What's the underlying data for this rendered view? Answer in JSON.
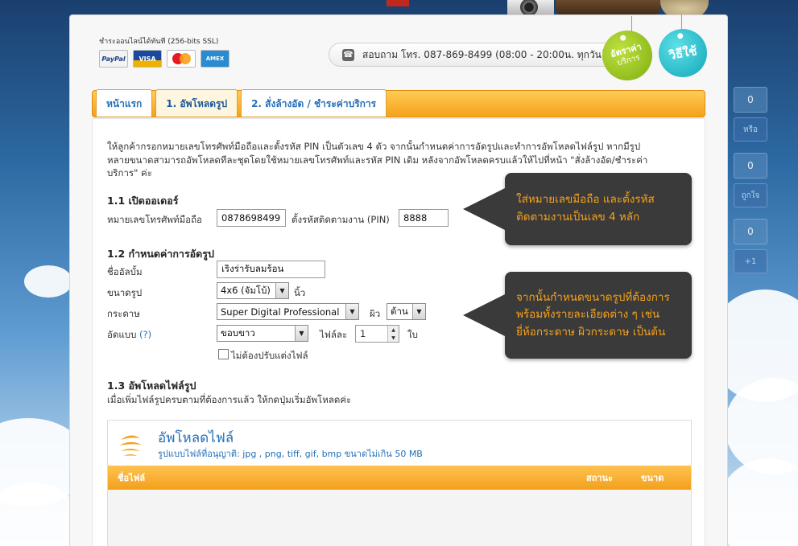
{
  "payment": {
    "label": "ชำระออนไลน์ได้ทันที (256-bits SSL)",
    "cards": [
      "PayPal",
      "VISA",
      "MasterCard",
      "AMERICAN EXPRESS"
    ]
  },
  "contact": {
    "text": "สอบถาม โทร. 087-869-8499 (08:00 - 20:00น. ทุกวัน)"
  },
  "tags": {
    "rate_line1": "อัตราค่า",
    "rate_line2": "บริการ",
    "howto": "วิธีใช้"
  },
  "tabs": [
    {
      "label": "หน้าแรก",
      "active": false
    },
    {
      "label": "1. อัพโหลดรูป",
      "active": true
    },
    {
      "label": "2. สั่งล้างอัด / ชำระค่าบริการ",
      "active": false
    }
  ],
  "intro": {
    "line1": "ให้ลูกค้ากรอกหมายเลขโทรศัพท์มือถือและตั้งรหัส PIN เป็นตัวเลข 4 ตัว จากนั้นกำหนดค่าการอัดรูปและทำการอัพโหลดไฟล์รูป หากมีรูป",
    "line2": "หลายขนาดสามารถอัพโหลดทีละชุดโดยใช้หมายเลขโทรศัพท์และรหัส PIN เดิม หลังจากอัพโหลดครบแล้วให้ไปที่หน้า \"สั่งล้างอัด/ชำระค่า",
    "line3": "บริการ\" ค่ะ"
  },
  "order": {
    "title": "1.1 เปิดออเดอร์",
    "phone_label": "หมายเลขโทรศัพท์มือถือ",
    "phone_value": "0878698499",
    "pin_label": "ตั้งรหัสติดตามงาน (PIN)",
    "pin_value": "8888"
  },
  "settings": {
    "title": "1.2 กำหนดค่าการอัดรูป",
    "album_label": "ชื่ออัลบั้ม",
    "album_value": "เริงร่ารับลมร้อน",
    "size_label": "ขนาดรูป",
    "size_value": "4x6 (จัมโบ้)",
    "size_unit": "นิ้ว",
    "paper_label": "กระดาษ",
    "paper_value": "Super Digital Professional",
    "surface_label": "ผิว",
    "surface_value": "ด้าน",
    "print_label": "อัดแบบ",
    "print_help": "(?)",
    "print_value": "ขอบขาว",
    "per_file_label": "ไฟล์ละ",
    "per_file_value": "1",
    "per_file_unit": "ใบ",
    "no_adjust_label": "ไม่ต้องปรับแต่งไฟล์",
    "no_adjust_checked": false
  },
  "upload": {
    "title": "1.3 อัพโหลดไฟล์รูป",
    "desc": "เมื่อเพิ่มไฟล์รูปครบตามที่ต้องการแล้ว ให้กดปุ่มเริ่มอัพโหลดค่ะ",
    "box_title": "อัพโหลดไฟล์",
    "box_sub": "รูปแบบไฟล์ที่อนุญาติ: jpg , png, tiff, gif, bmp ขนาดไม่เกิน 50 MB",
    "col_filename": "ชื่อไฟล์",
    "col_status": "สถานะ",
    "col_size": "ขนาด"
  },
  "tooltips": {
    "tip1_line1": "ใส่หมายเลขมือถือ และตั้งรหัส",
    "tip1_line2": "ติดตามงานเป็นเลข 4 หลัก",
    "tip2_line1": "จากนั้นกำหนดขนาดรูปที่ต้องการ",
    "tip2_line2": "พร้อมทั้งรายละเอียดต่าง ๆ เช่น",
    "tip2_line3": "ยี่ห้อกระดาษ ผิวกระดาษ เป็นต้น"
  },
  "social": [
    {
      "count": "0",
      "label": "หรือ"
    },
    {
      "count": "0",
      "label": "ถูกใจ"
    },
    {
      "count": "0",
      "label": "+1"
    }
  ],
  "colors": {
    "accent_orange": "#f4a21a",
    "link_blue": "#2570b8",
    "tooltip_bg": "#3a3a3a",
    "tooltip_text": "#f7a21b",
    "tag_green": "#8dbf14",
    "tag_cyan": "#1ab3c4"
  }
}
